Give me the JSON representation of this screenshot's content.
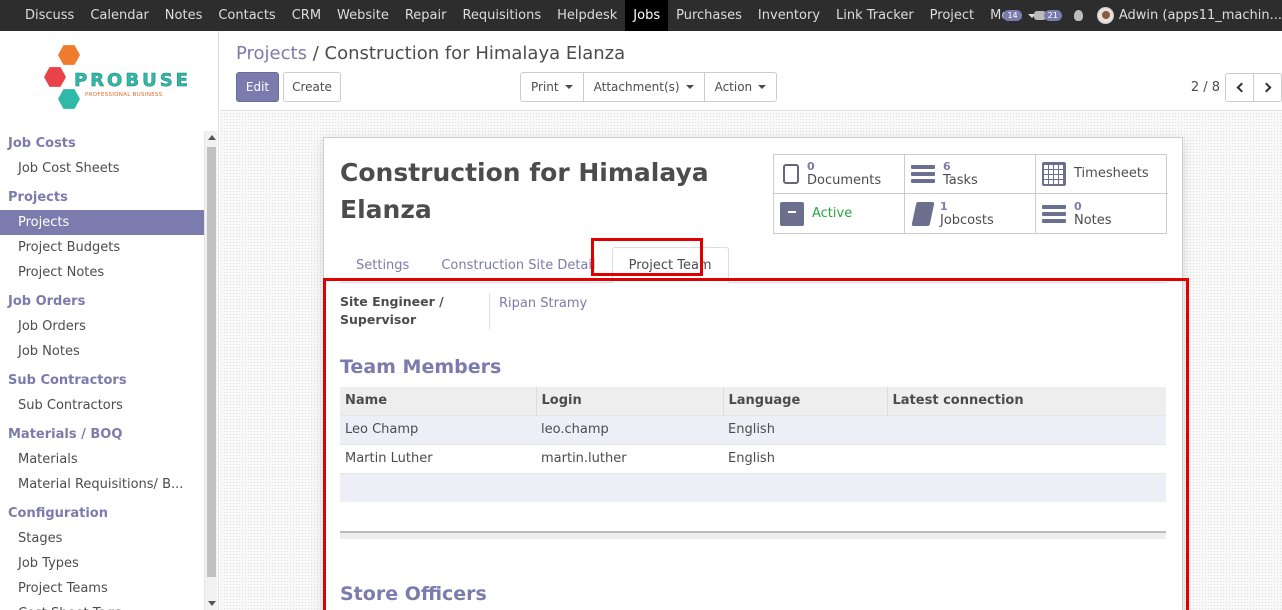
{
  "topbar": {
    "menu": [
      {
        "label": "Discuss",
        "key": "discuss"
      },
      {
        "label": "Calendar",
        "key": "calendar"
      },
      {
        "label": "Notes",
        "key": "notes"
      },
      {
        "label": "Contacts",
        "key": "contacts"
      },
      {
        "label": "CRM",
        "key": "crm"
      },
      {
        "label": "Website",
        "key": "website"
      },
      {
        "label": "Repair",
        "key": "repair"
      },
      {
        "label": "Requisitions",
        "key": "requisitions"
      },
      {
        "label": "Helpdesk",
        "key": "helpdesk"
      },
      {
        "label": "Jobs",
        "key": "jobs",
        "active": true
      },
      {
        "label": "Purchases",
        "key": "purchases"
      },
      {
        "label": "Inventory",
        "key": "inventory"
      },
      {
        "label": "Link Tracker",
        "key": "link-tracker"
      },
      {
        "label": "Project",
        "key": "project"
      },
      {
        "label": "More",
        "key": "more",
        "dropdown": true
      }
    ],
    "messages_count": "14",
    "chat_count": "21",
    "user_name": "Adwin (apps11_machin..."
  },
  "logo": {
    "name": "PROBUSE",
    "tagline": "PROFESSIONAL BUSINESS"
  },
  "sidebar": {
    "sections": [
      {
        "title": "Job Costs",
        "items": [
          {
            "label": "Job Cost Sheets"
          }
        ]
      },
      {
        "title": "Projects",
        "items": [
          {
            "label": "Projects",
            "active": true
          },
          {
            "label": "Project Budgets"
          },
          {
            "label": "Project Notes"
          }
        ]
      },
      {
        "title": "Job Orders",
        "items": [
          {
            "label": "Job Orders"
          },
          {
            "label": "Job Notes"
          }
        ]
      },
      {
        "title": "Sub Contractors",
        "items": [
          {
            "label": "Sub Contractors"
          }
        ]
      },
      {
        "title": "Materials / BOQ",
        "items": [
          {
            "label": "Materials"
          },
          {
            "label": "Material Requisitions/ B..."
          }
        ]
      },
      {
        "title": "Configuration",
        "items": [
          {
            "label": "Stages"
          },
          {
            "label": "Job Types"
          },
          {
            "label": "Project Teams"
          },
          {
            "label": "Cost Sheet Tags"
          }
        ]
      }
    ]
  },
  "control": {
    "breadcrumb_parent": "Projects",
    "breadcrumb_sep": "/",
    "breadcrumb_current": "Construction for Himalaya Elanza",
    "edit_label": "Edit",
    "create_label": "Create",
    "print_label": "Print",
    "attachments_label": "Attachment(s)",
    "action_label": "Action",
    "pager": "2 / 8"
  },
  "record": {
    "title": "Construction for Himalaya Elanza",
    "smart_buttons": [
      {
        "count": "0",
        "label": "Documents",
        "icon": "documents-icon"
      },
      {
        "count": "6",
        "label": "Tasks",
        "icon": "tasks-icon"
      },
      {
        "count": "",
        "label": "Timesheets",
        "icon": "calendar-icon"
      },
      {
        "count": "",
        "label": "Active",
        "icon": "archive-icon",
        "status": true
      },
      {
        "count": "1",
        "label": "Jobcosts",
        "icon": "book-icon"
      },
      {
        "count": "0",
        "label": "Notes",
        "icon": "notes-icon"
      }
    ],
    "tabs": [
      {
        "label": "Settings"
      },
      {
        "label": "Construction Site Detail"
      },
      {
        "label": "Project Team",
        "active": true
      }
    ],
    "site_engineer_label": "Site Engineer / Supervisor",
    "site_engineer_value": "Ripan Stramy",
    "team_members_title": "Team Members",
    "team_columns": [
      "Name",
      "Login",
      "Language",
      "Latest connection"
    ],
    "team_rows": [
      [
        "Leo Champ",
        "leo.champ",
        "English",
        ""
      ],
      [
        "Martin Luther",
        "martin.luther",
        "English",
        ""
      ]
    ],
    "store_officers_title": "Store Officers"
  },
  "colors": {
    "accent": "#7c7bad",
    "topbar": "#2e2d2d",
    "highlight": "#e00000",
    "active_status": "#28a745"
  }
}
